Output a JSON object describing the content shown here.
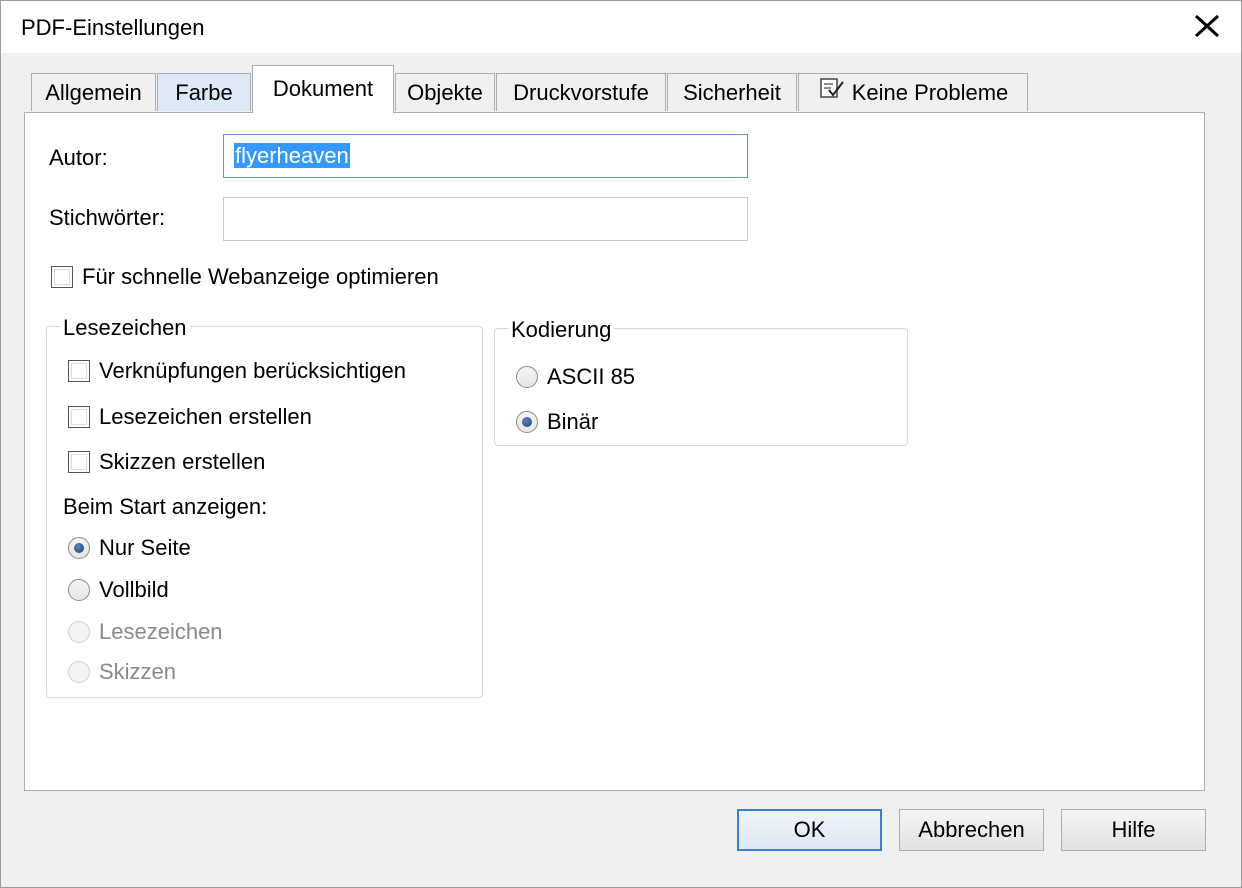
{
  "window": {
    "title": "PDF-Einstellungen",
    "close_glyph": "✕"
  },
  "tabs": [
    {
      "label": "Allgemein"
    },
    {
      "label": "Farbe"
    },
    {
      "label": "Dokument"
    },
    {
      "label": "Objekte"
    },
    {
      "label": "Druckvorstufe"
    },
    {
      "label": "Sicherheit"
    },
    {
      "label": "Keine Probleme",
      "icon": "checklist-icon"
    }
  ],
  "active_tab": "Dokument",
  "fields": {
    "author_label": "Autor:",
    "author_value": "flyerheaven",
    "keywords_label": "Stichwörter:",
    "keywords_value": ""
  },
  "web_optimize": {
    "label": "Für schnelle Webanzeige optimieren",
    "checked": false
  },
  "bookmarks_group": {
    "title": "Lesezeichen",
    "checkboxes": [
      {
        "label": "Verknüpfungen berücksichtigen",
        "checked": false
      },
      {
        "label": "Lesezeichen erstellen",
        "checked": false
      },
      {
        "label": "Skizzen erstellen",
        "checked": false
      }
    ],
    "start_label": "Beim Start anzeigen:",
    "start_options": [
      {
        "label": "Nur Seite",
        "checked": true,
        "enabled": true
      },
      {
        "label": "Vollbild",
        "checked": false,
        "enabled": true
      },
      {
        "label": "Lesezeichen",
        "checked": false,
        "enabled": false
      },
      {
        "label": "Skizzen",
        "checked": false,
        "enabled": false
      }
    ]
  },
  "encoding_group": {
    "title": "Kodierung",
    "options": [
      {
        "label": "ASCII 85",
        "checked": false
      },
      {
        "label": "Binär",
        "checked": true
      }
    ]
  },
  "buttons": {
    "ok": "OK",
    "cancel": "Abbrechen",
    "help": "Hilfe"
  }
}
